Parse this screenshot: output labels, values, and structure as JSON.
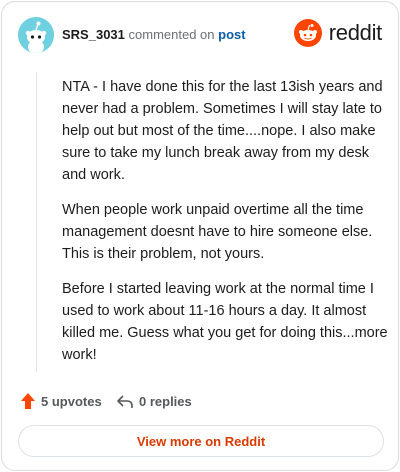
{
  "header": {
    "username": "SRS_3031",
    "action_text": "commented on",
    "post_link": "post",
    "brand": "reddit",
    "avatar_icon": "reddit-snoo-avatar-icon",
    "brand_icon": "reddit-logo-icon"
  },
  "comment": {
    "paragraphs": [
      "NTA - I have done this for the last 13ish years and never had a problem. Sometimes I will stay late to help out but most of the time....nope. I also make sure to take my lunch break away from my desk and work.",
      "When people work unpaid overtime all the time management doesnt have to hire someone else. This is their problem, not yours.",
      "Before I started leaving work at the normal time I used to work about 11-16 hours a day. It almost killed me. Guess what you get for doing this...more work!"
    ]
  },
  "actions": {
    "upvotes_label": "5 upvotes",
    "replies_label": "0 replies",
    "upvote_icon": "upvote-arrow-icon",
    "reply_icon": "reply-arrow-icon"
  },
  "footer": {
    "view_more_label": "View more on Reddit"
  },
  "colors": {
    "accent": "#d93a00",
    "link": "#0b5ea8",
    "avatar_bg": "#6fd0e0",
    "upvote": "#ff4500"
  }
}
